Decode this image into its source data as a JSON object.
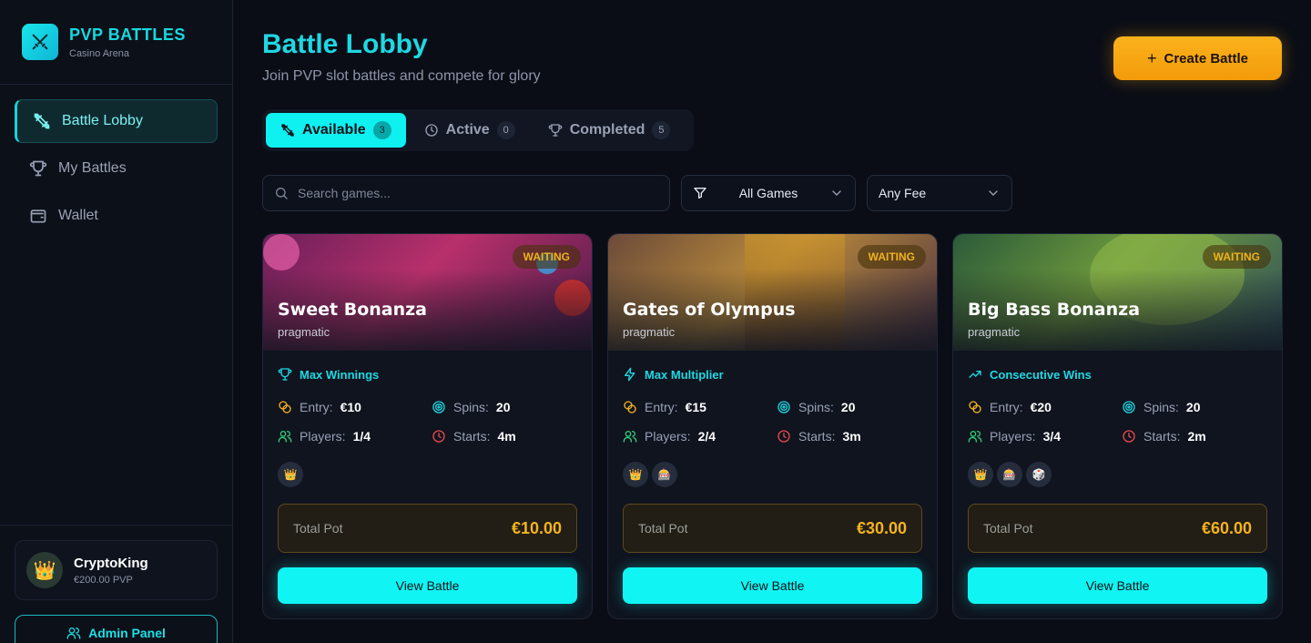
{
  "brand": {
    "title": "PVP BATTLES",
    "subtitle": "Casino Arena"
  },
  "sidebar": {
    "items": [
      {
        "label": "Battle Lobby",
        "icon": "swords-icon",
        "active": true
      },
      {
        "label": "My Battles",
        "icon": "trophy-icon",
        "active": false
      },
      {
        "label": "Wallet",
        "icon": "wallet-icon",
        "active": false
      }
    ]
  },
  "user": {
    "name": "CryptoKing",
    "balance": "€200.00 PVP",
    "avatar": "👑"
  },
  "admin": {
    "label": "Admin Panel"
  },
  "header": {
    "title": "Battle Lobby",
    "subtitle": "Join PVP slot battles and compete for glory",
    "create_label": "Create Battle"
  },
  "tabs": [
    {
      "label": "Available",
      "count": "3",
      "active": true
    },
    {
      "label": "Active",
      "count": "0",
      "active": false
    },
    {
      "label": "Completed",
      "count": "5",
      "active": false
    }
  ],
  "filters": {
    "search_placeholder": "Search games...",
    "game_filter": "All Games",
    "fee_filter": "Any Fee"
  },
  "cards": [
    {
      "title": "Sweet Bonanza",
      "provider": "pragmatic",
      "status": "WAITING",
      "mode": "Max Winnings",
      "entry_label": "Entry:",
      "entry": "€10",
      "spins_label": "Spins:",
      "spins": "20",
      "players_label": "Players:",
      "players": "1/4",
      "starts_label": "Starts:",
      "starts": "4m",
      "icons": [
        "👑"
      ],
      "pot_label": "Total Pot",
      "pot": "€10.00",
      "button": "View Battle"
    },
    {
      "title": "Gates of Olympus",
      "provider": "pragmatic",
      "status": "WAITING",
      "mode": "Max Multiplier",
      "entry_label": "Entry:",
      "entry": "€15",
      "spins_label": "Spins:",
      "spins": "20",
      "players_label": "Players:",
      "players": "2/4",
      "starts_label": "Starts:",
      "starts": "3m",
      "icons": [
        "👑",
        "🎰"
      ],
      "pot_label": "Total Pot",
      "pot": "€30.00",
      "button": "View Battle"
    },
    {
      "title": "Big Bass Bonanza",
      "provider": "pragmatic",
      "status": "WAITING",
      "mode": "Consecutive Wins",
      "entry_label": "Entry:",
      "entry": "€20",
      "spins_label": "Spins:",
      "spins": "20",
      "players_label": "Players:",
      "players": "3/4",
      "starts_label": "Starts:",
      "starts": "2m",
      "icons": [
        "👑",
        "🎰",
        "🎲"
      ],
      "pot_label": "Total Pot",
      "pot": "€60.00",
      "button": "View Battle"
    }
  ],
  "colors": {
    "accent": "#10f5f3",
    "gold": "#f4b41c",
    "background": "#0a0d16"
  }
}
